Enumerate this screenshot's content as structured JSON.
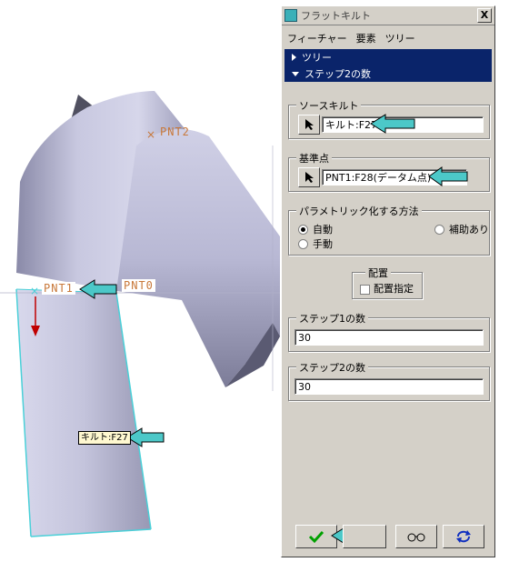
{
  "viewport": {
    "labels": {
      "pnt2": "PNT2",
      "pnt1": "PNT1",
      "pnt0": "PNT0",
      "quilt_tag": "キルト:F27"
    },
    "colors": {
      "surface": "#b8b8d8",
      "surface_dark": "#6e6e88",
      "edge": "#4ad0d8",
      "label": "#c8783a",
      "callout": "#4cc8c8"
    }
  },
  "dialog": {
    "title": "フラットキルト",
    "close_label": "X",
    "menu": [
      "フィーチャー",
      "要素",
      "ツリー"
    ],
    "tree_item": "ツリー",
    "step_item": "ステップ2の数",
    "source_quilt": {
      "legend": "ソースキルト",
      "value": "キルト:F27"
    },
    "reference_point": {
      "legend": "基準点",
      "value": "PNT1:F28(データム点)"
    },
    "parametric": {
      "legend": "パラメトリック化する方法",
      "auto": "自動",
      "interp": "補助あり",
      "manual": "手動",
      "selected": "自動"
    },
    "placement": {
      "legend": "配置",
      "checkbox_label": "配置指定",
      "checked": false
    },
    "step1": {
      "legend": "ステップ1の数",
      "value": "30"
    },
    "step2": {
      "legend": "ステップ2の数",
      "value": "30"
    },
    "icons": {
      "ok": "check-icon",
      "cancel": "cancel-icon",
      "preview": "glasses-icon",
      "repaint": "repaint-icon"
    }
  }
}
